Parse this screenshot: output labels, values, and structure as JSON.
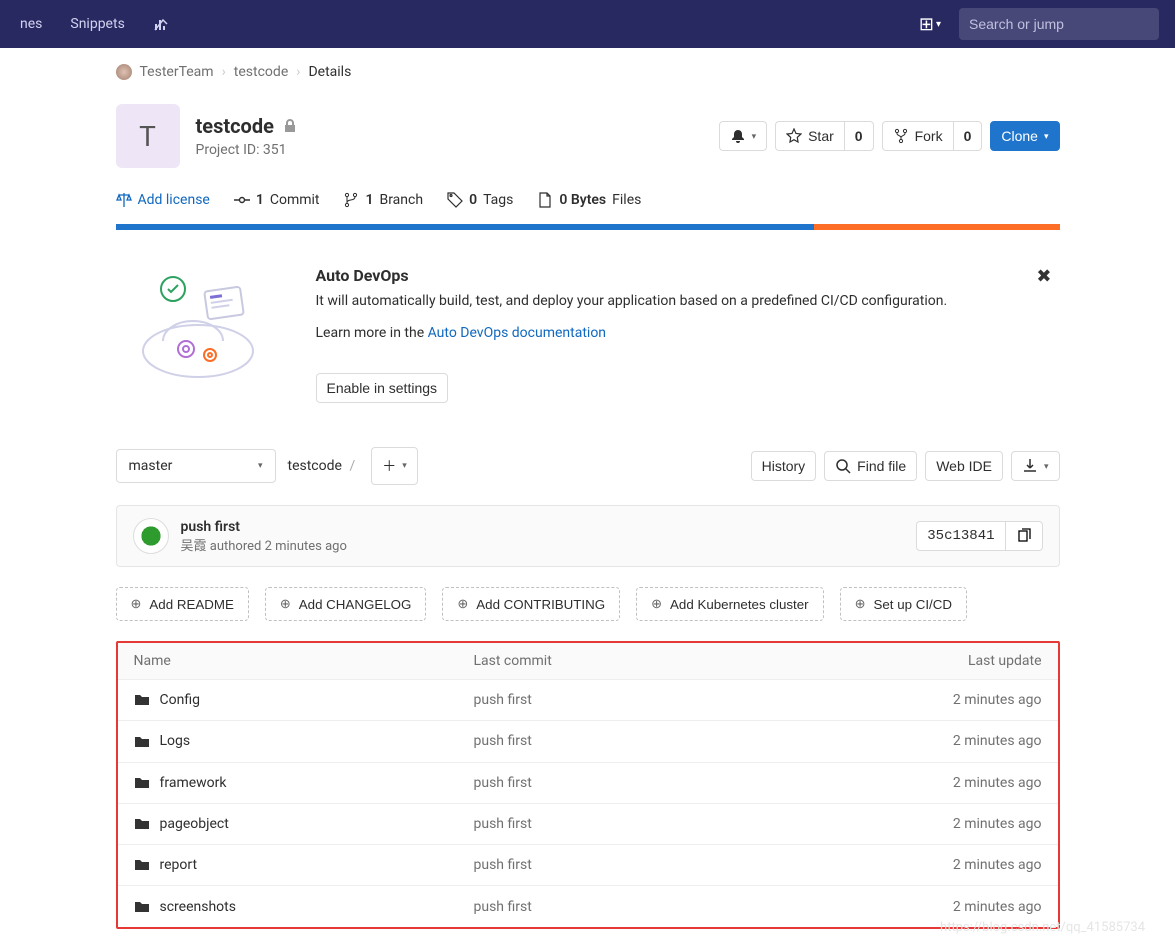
{
  "topnav": {
    "item1": "nes",
    "item2": "Snippets",
    "search_placeholder": "Search or jump"
  },
  "breadcrumb": {
    "group": "TesterTeam",
    "project": "testcode",
    "current": "Details"
  },
  "project": {
    "avatar_letter": "T",
    "name": "testcode",
    "id_label": "Project ID: 351",
    "star_label": "Star",
    "star_count": "0",
    "fork_label": "Fork",
    "fork_count": "0",
    "clone_label": "Clone"
  },
  "stats": {
    "add_license": "Add license",
    "commits_n": "1",
    "commits_label": "Commit",
    "branch_n": "1",
    "branch_label": "Branch",
    "tags_n": "0",
    "tags_label": "Tags",
    "size_n": "0 Bytes",
    "size_label": "Files"
  },
  "devops": {
    "title": "Auto DevOps",
    "desc": "It will automatically build, test, and deploy your application based on a predefined CI/CD configuration.",
    "learn_prefix": "Learn more in the ",
    "learn_link": "Auto DevOps documentation",
    "enable_btn": "Enable in settings"
  },
  "tree": {
    "branch": "master",
    "path_root": "testcode",
    "history": "History",
    "find": "Find file",
    "ide": "Web IDE"
  },
  "commit": {
    "title": "push first",
    "author": "吴霞",
    "authored": "authored",
    "time": "2 minutes ago",
    "sha": "35c13841"
  },
  "addrow": {
    "readme": "Add README",
    "changelog": "Add CHANGELOG",
    "contributing": "Add CONTRIBUTING",
    "k8s": "Add Kubernetes cluster",
    "cicd": "Set up CI/CD"
  },
  "table": {
    "h_name": "Name",
    "h_commit": "Last commit",
    "h_update": "Last update",
    "rows": [
      {
        "name": "Config",
        "commit": "push first",
        "update": "2 minutes ago"
      },
      {
        "name": "Logs",
        "commit": "push first",
        "update": "2 minutes ago"
      },
      {
        "name": "framework",
        "commit": "push first",
        "update": "2 minutes ago"
      },
      {
        "name": "pageobject",
        "commit": "push first",
        "update": "2 minutes ago"
      },
      {
        "name": "report",
        "commit": "push first",
        "update": "2 minutes ago"
      },
      {
        "name": "screenshots",
        "commit": "push first",
        "update": "2 minutes ago"
      }
    ]
  },
  "watermark": "https://blog.csdn.net/qq_41585734"
}
